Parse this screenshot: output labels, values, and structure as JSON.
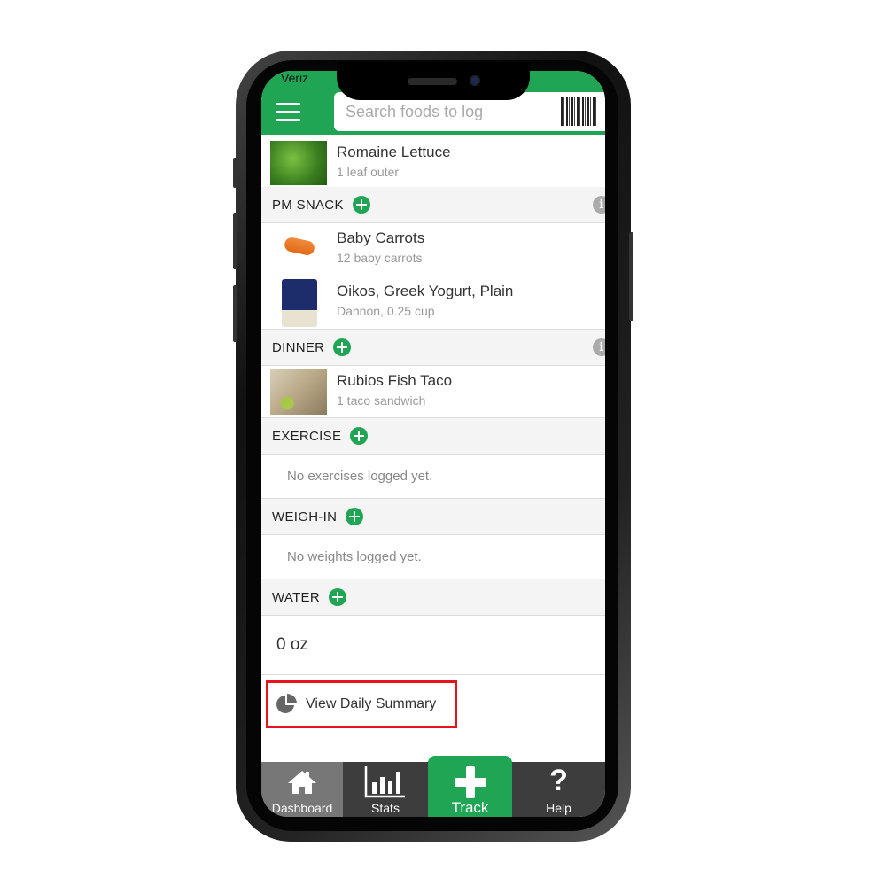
{
  "status_bar": {
    "carrier": "Veriz"
  },
  "header": {
    "search_placeholder": "Search foods to log",
    "colors": {
      "brand": "#1fa553",
      "highlight": "#e8131b"
    }
  },
  "log": {
    "top_items": [
      {
        "name": "Romaine Lettuce",
        "detail": "1 leaf outer"
      }
    ],
    "pm_snack": {
      "title": "PM SNACK",
      "items": [
        {
          "name": "Baby Carrots",
          "detail": "12 baby carrots"
        },
        {
          "name": "Oikos, Greek Yogurt, Plain",
          "detail": "Dannon, 0.25 cup"
        }
      ]
    },
    "dinner": {
      "title": "DINNER",
      "items": [
        {
          "name": "Rubios Fish Taco",
          "detail": "1 taco sandwich"
        }
      ]
    },
    "exercise": {
      "title": "EXERCISE",
      "empty": "No exercises logged yet."
    },
    "weigh_in": {
      "title": "WEIGH-IN",
      "empty": "No weights logged yet."
    },
    "water": {
      "title": "WATER",
      "value": "0 oz"
    },
    "summary_link": "View Daily Summary"
  },
  "tabbar": {
    "tabs": [
      {
        "label": "Dashboard",
        "icon": "home-icon"
      },
      {
        "label": "Stats",
        "icon": "bar-chart-icon"
      },
      {
        "label": "Track",
        "icon": "plus-icon"
      },
      {
        "label": "Help",
        "icon": "question-icon"
      }
    ]
  }
}
